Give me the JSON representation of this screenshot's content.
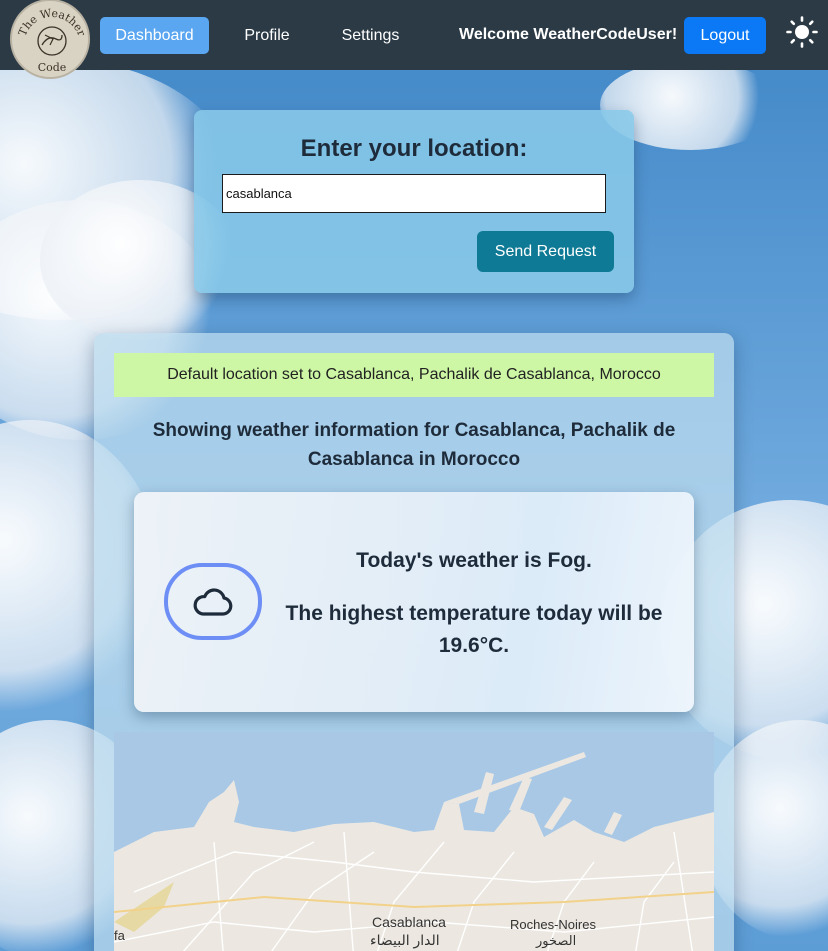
{
  "nav": {
    "logo_text_top": "The Weather",
    "logo_text_bottom": "Code",
    "items": [
      {
        "label": "Dashboard",
        "active": true
      },
      {
        "label": "Profile",
        "active": false
      },
      {
        "label": "Settings",
        "active": false
      }
    ],
    "welcome": "Welcome WeatherCodeUser!",
    "logout_label": "Logout",
    "theme_icon": "sun-icon"
  },
  "location": {
    "title": "Enter your location:",
    "input_value": "casablanca",
    "send_label": "Send Request"
  },
  "main": {
    "alert": "Default location set to Casablanca, Pachalik de Casablanca, Morocco",
    "showing": "Showing weather information for Casablanca, Pachalik de Casablanca in Morocco",
    "weather_icon": "cloud-icon",
    "today": "Today's weather is Fog.",
    "high": "The highest temperature today will be 19.6°C."
  },
  "map": {
    "labels": {
      "casablanca": "Casablanca",
      "casablanca_ar": "الدار البيضاء",
      "roches_noires": "Roches-Noires",
      "roches_noires_ar": "الصخور",
      "partial": "fa"
    }
  },
  "colors": {
    "navbar": "#2b3a45",
    "active_nav": "#5aa6f0",
    "logout": "#0b79f5",
    "send": "#0f7a95",
    "alert": "#cdf7a4",
    "icon_ring": "#6d8ef5"
  }
}
